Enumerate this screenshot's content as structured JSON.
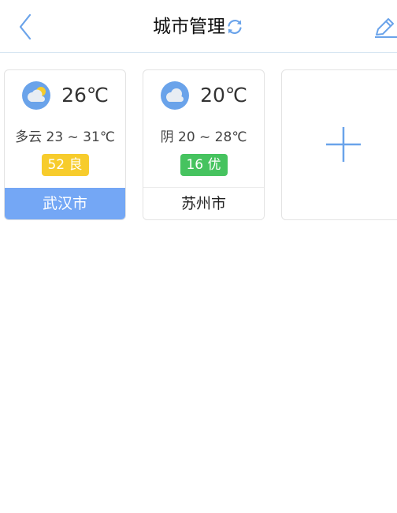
{
  "header": {
    "title": "城市管理",
    "back_icon": "chevron-left-icon",
    "refresh_icon": "refresh-icon",
    "edit_icon": "edit-pencil-icon"
  },
  "cities": [
    {
      "condition_icon": "partly-cloudy-icon",
      "temperature": "26℃",
      "forecast": "多云 23 ~ 31℃",
      "aqi": "52 良",
      "aqi_color": "#f7cc2c",
      "city": "武汉市",
      "selected": true
    },
    {
      "condition_icon": "cloudy-icon",
      "temperature": "20℃",
      "forecast": "阴 20 ~ 28℃",
      "aqi": "16 优",
      "aqi_color": "#46c35f",
      "city": "苏州市",
      "selected": false
    }
  ],
  "add_card": {
    "icon": "plus-icon"
  },
  "colors": {
    "accent": "#74a7f5",
    "icon_blue": "#6aa3ea",
    "divider": "#d7e6f2"
  }
}
